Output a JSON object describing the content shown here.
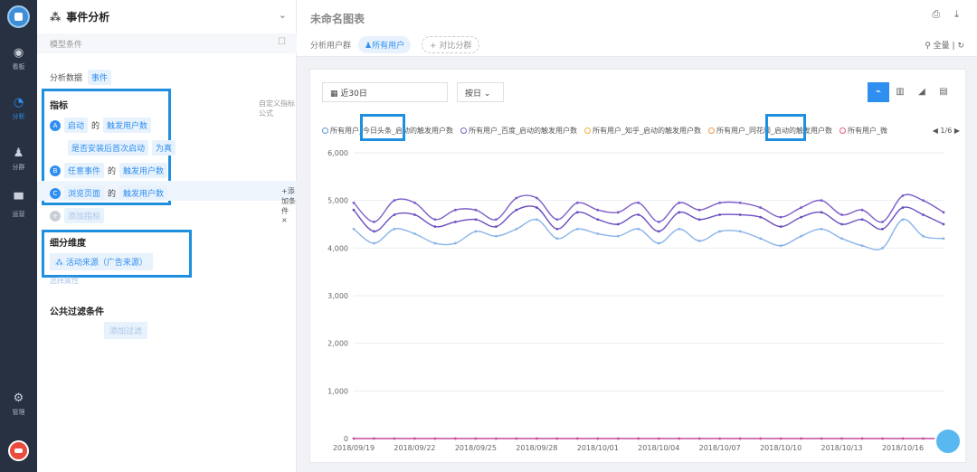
{
  "nav": {
    "items": [
      {
        "name": "dashboard",
        "label": "看板",
        "icon": "dashboard-icon"
      },
      {
        "name": "analysis",
        "label": "分析",
        "icon": "pie-chart-icon"
      },
      {
        "name": "users",
        "label": "分群",
        "icon": "user-group-icon"
      },
      {
        "name": "campaign",
        "label": "运营",
        "icon": "monitor-icon"
      },
      {
        "name": "settings",
        "label": "管理",
        "icon": "gear-icon"
      }
    ]
  },
  "panel": {
    "title": "事件分析",
    "model_label": "模型条件",
    "basis_label": "分析数据",
    "basis_value": "事件",
    "metrics_title": "指标",
    "custom_formula": "自定义指标公式",
    "metrics": [
      {
        "badge": "A",
        "event": "启动",
        "of": "的",
        "measure": "触发用户数"
      },
      {
        "badge": "B",
        "event": "任意事件",
        "of": "的",
        "measure": "触发用户数"
      },
      {
        "badge": "C",
        "event": "浏览页面",
        "of": "的",
        "measure": "触发用户数"
      }
    ],
    "metric_a_filter": {
      "prop": "是否安装后首次启动",
      "value": "为真"
    },
    "add_condition": "+添加条件 ×",
    "add_metric": "添加指标",
    "dimension_title": "细分维度",
    "dimension_value": "活动来源（广告来源）",
    "select_attr": "选择属性",
    "filter_title": "公共过滤条件",
    "filter_button": "添加过滤"
  },
  "main": {
    "chart_title": "未命名图表",
    "group_label": "分析用户群",
    "group_chip": "所有用户",
    "compare": "+ 对比分群",
    "all_label": "全量",
    "date_range": "近30日",
    "granularity": "按日"
  },
  "legend": [
    {
      "label": "所有用户_今日头条_启动的触发用户数",
      "color": "#5b9bd5"
    },
    {
      "label": "所有用户_百度_启动的触发用户数",
      "color": "#7d5dc9"
    },
    {
      "label": "所有用户_知乎_启动的触发用户数",
      "color": "#f0b13a"
    },
    {
      "label": "所有用户_同花顺_启动的触发用户数",
      "color": "#f29a4a"
    },
    {
      "label": "所有用户_微",
      "color": "#e35f7c"
    }
  ],
  "legend_pager": "1/6",
  "colors": {
    "accent": "#2f8ff0",
    "highlight": "#1f8fe0"
  },
  "chart_data": {
    "type": "line",
    "x": [
      "2018/09/19",
      "2018/09/20",
      "2018/09/21",
      "2018/09/22",
      "2018/09/23",
      "2018/09/24",
      "2018/09/25",
      "2018/09/26",
      "2018/09/27",
      "2018/09/28",
      "2018/09/29",
      "2018/09/30",
      "2018/10/01",
      "2018/10/02",
      "2018/10/03",
      "2018/10/04",
      "2018/10/05",
      "2018/10/06",
      "2018/10/07",
      "2018/10/08",
      "2018/10/09",
      "2018/10/10",
      "2018/10/11",
      "2018/10/12",
      "2018/10/13",
      "2018/10/14",
      "2018/10/15",
      "2018/10/16",
      "2018/10/17",
      "2018/10/18"
    ],
    "xticks": [
      "2018/09/19",
      "2018/09/22",
      "2018/09/25",
      "2018/09/28",
      "2018/10/01",
      "2018/10/04",
      "2018/10/07",
      "2018/10/10",
      "2018/10/13",
      "2018/10/16"
    ],
    "yticks": [
      0,
      1000,
      2000,
      3000,
      4000,
      5000,
      6000
    ],
    "ytick_labels": [
      "0",
      "1,000",
      "2,000",
      "3,000",
      "4,000",
      "5,000",
      "6,000"
    ],
    "ylim": [
      0,
      6000
    ],
    "series": [
      {
        "color": "#7d5dc9",
        "values": [
          4950,
          4550,
          5000,
          4950,
          4600,
          4800,
          4800,
          4600,
          5050,
          5050,
          4600,
          4950,
          4800,
          4750,
          4950,
          4550,
          4950,
          4800,
          4950,
          4950,
          4850,
          4650,
          4850,
          5000,
          4700,
          4800,
          4550,
          5100,
          5000,
          4750
        ]
      },
      {
        "color": "#6c4fc0",
        "values": [
          4800,
          4350,
          4700,
          4700,
          4450,
          4550,
          4600,
          4450,
          4800,
          4850,
          4400,
          4750,
          4600,
          4500,
          4700,
          4350,
          4750,
          4600,
          4700,
          4700,
          4650,
          4450,
          4650,
          4750,
          4500,
          4600,
          4400,
          4850,
          4700,
          4500
        ]
      },
      {
        "color": "#8ab4e8",
        "values": [
          4400,
          4100,
          4400,
          4300,
          4100,
          4100,
          4350,
          4250,
          4400,
          4600,
          4200,
          4400,
          4300,
          4250,
          4400,
          4100,
          4400,
          4150,
          4350,
          4350,
          4200,
          4050,
          4250,
          4400,
          4200,
          4050,
          4000,
          4600,
          4250,
          4200
        ]
      },
      {
        "color": "#c94a9b",
        "values": [
          0,
          0,
          0,
          0,
          0,
          0,
          0,
          0,
          0,
          0,
          0,
          0,
          0,
          0,
          0,
          0,
          0,
          0,
          0,
          0,
          0,
          0,
          0,
          0,
          0,
          0,
          0,
          0,
          0,
          0
        ]
      }
    ]
  }
}
